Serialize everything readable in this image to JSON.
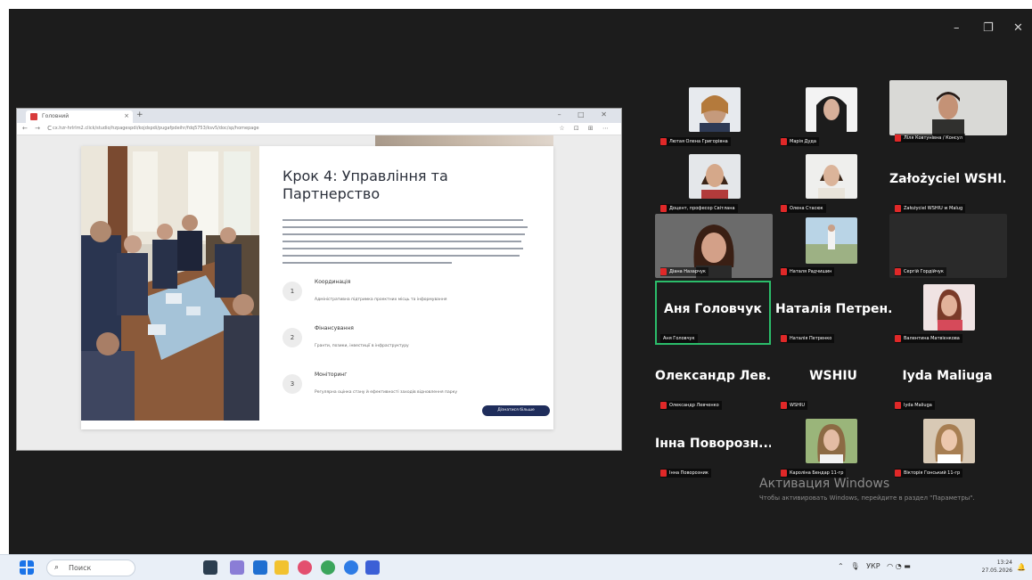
{
  "window": {
    "minimize": "–",
    "maximize": "❐",
    "close": "✕"
  },
  "shared_browser": {
    "tab_title": "Головний",
    "tab_close": "×",
    "new_tab": "+",
    "nav": "← → C",
    "url": "cx.hzr-hrlrlm2.click/studio/hzpagespdi/kojdspdi/pugafpdeihr/fdq5753/ksv5/doc/sp/homepage",
    "ext": "☆ ⊡ ⊞ ⋯",
    "controls": "– □ ✕"
  },
  "slide": {
    "title": "Крок 4: Управління та Партнерство",
    "steps": [
      {
        "num": "1",
        "title": "Координація",
        "text": "Адміністративна підтримка проектних місць та інформування"
      },
      {
        "num": "2",
        "title": "Фінансування",
        "text": "Гранти, позики, інвестиції в інфраструктуру"
      },
      {
        "num": "3",
        "title": "Моніторинг",
        "text": "Регулярна оцінка стану й ефективності заходів відновлення парку"
      }
    ],
    "button": "Дізнатися більше"
  },
  "participants": [
    {
      "label": "Лютая Олена Григорівна"
    },
    {
      "label": "Марія Дуда"
    },
    {
      "label": "Ліля Ковтунівна / Консул"
    },
    {
      "label": "Доцент, професор Світлана"
    },
    {
      "label": "Олена Стасюк"
    },
    {
      "name": "Założyciel WSHI...",
      "label": "Założyciel WSHIU w Malug"
    },
    {
      "label": "Діана Назарчук"
    },
    {
      "label": "Наталя Радчишин"
    },
    {
      "label": "Сергій Гордійчук"
    },
    {
      "name": "Аня Головчук",
      "label": "Аня Головчук"
    },
    {
      "name": "Наталія Петрен...",
      "label": "Наталія Петренко"
    },
    {
      "label": "Валентина Матвієнкова"
    },
    {
      "name": "Олександр Лев...",
      "label": "Олександр Левченко"
    },
    {
      "name": "WSHIU",
      "label": "WSHIU"
    },
    {
      "name": "Iyda Maliuga",
      "label": "Iyda Maliuga"
    },
    {
      "name": "Інна Поворозн...",
      "label": "Інна Поворозник"
    },
    {
      "label": "Кароліна Бендар 11-гр"
    },
    {
      "label": "Вікторія Гонський 11-гр"
    }
  ],
  "activation": {
    "title": "Активация Windows",
    "line": "Чтобы активировать Windows, перейдите в раздел \"Параметры\"."
  },
  "taskbar": {
    "search": "Поиск",
    "lang": "УКР",
    "time": "13:24",
    "date": "27.05.2026",
    "colors": {
      "start": "#1a73e8",
      "accent": "#2bbd6a",
      "mic": "#e02828"
    }
  }
}
